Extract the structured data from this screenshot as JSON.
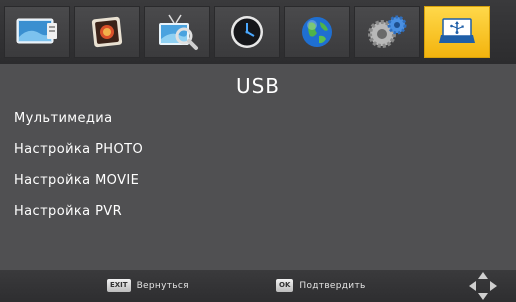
{
  "topbar": {
    "tabs": [
      {
        "icon": "tv-picture-icon"
      },
      {
        "icon": "photo-icon"
      },
      {
        "icon": "channel-search-icon"
      },
      {
        "icon": "clock-icon"
      },
      {
        "icon": "globe-icon"
      },
      {
        "icon": "gears-settings-icon"
      },
      {
        "icon": "usb-icon",
        "active": true
      }
    ],
    "active_color": "#f5c020"
  },
  "main": {
    "title": "USB",
    "menu": [
      "Мультимедиа",
      "Настройка PHOTO",
      "Настройка MOVIE",
      "Настройка PVR"
    ]
  },
  "footer": {
    "exit_key": "EXIT",
    "exit_label": "Вернуться",
    "ok_key": "OK",
    "ok_label": "Подтвердить"
  }
}
